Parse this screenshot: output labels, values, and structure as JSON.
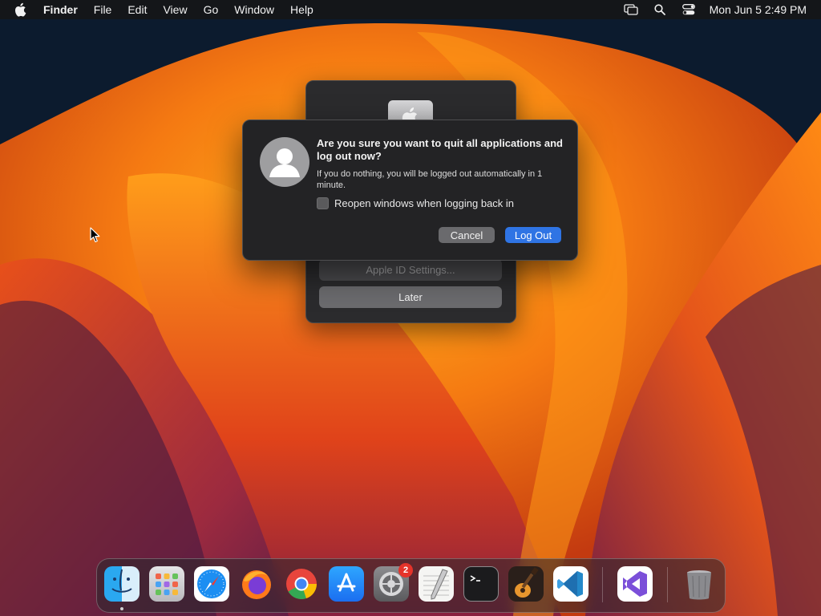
{
  "menubar": {
    "app_name": "Finder",
    "menus": [
      "File",
      "Edit",
      "View",
      "Go",
      "Window",
      "Help"
    ],
    "clock": "Mon Jun 5  2:49 PM"
  },
  "back_sheet": {
    "apple_id_button": "Apple ID Settings...",
    "later_button": "Later"
  },
  "dialog": {
    "title": "Are you sure you want to quit all applications and log out now?",
    "message": "If you do nothing, you will be logged out automatically in 1 minute.",
    "checkbox_label": "Reopen windows when logging back in",
    "checkbox_checked": false,
    "cancel_label": "Cancel",
    "logout_label": "Log Out"
  },
  "dock": {
    "apps": [
      {
        "name": "Finder",
        "icon": "finder-icon",
        "running": true
      },
      {
        "name": "Launchpad",
        "icon": "launchpad-icon"
      },
      {
        "name": "Safari",
        "icon": "safari-icon"
      },
      {
        "name": "Firefox",
        "icon": "firefox-icon"
      },
      {
        "name": "Chrome",
        "icon": "chrome-icon"
      },
      {
        "name": "App Store",
        "icon": "app-store-icon"
      },
      {
        "name": "System Settings",
        "icon": "system-settings-icon",
        "badge": "2"
      },
      {
        "name": "TextEdit",
        "icon": "textedit-icon"
      },
      {
        "name": "Terminal",
        "icon": "terminal-icon"
      },
      {
        "name": "GarageBand",
        "icon": "garageband-icon"
      },
      {
        "name": "Visual Studio Code",
        "icon": "vscode-icon"
      },
      {
        "name": "Visual Studio",
        "icon": "visual-studio-icon"
      },
      {
        "name": "Trash",
        "icon": "trash-icon"
      }
    ]
  },
  "colors": {
    "accent": "#2f74e4",
    "badge": "#e5332a"
  }
}
